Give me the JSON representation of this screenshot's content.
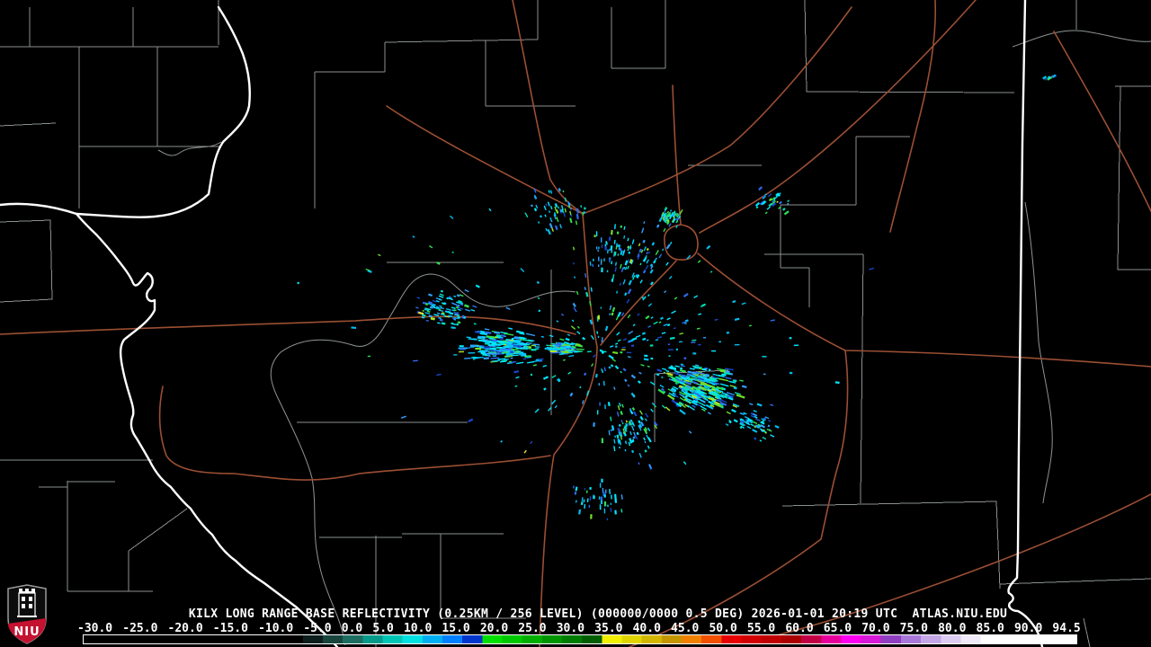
{
  "header": {
    "title": "KILX LONG RANGE BASE REFLECTIVITY (0.25KM / 256 LEVEL) (000000/0000 0.5 DEG) 2026-01-01 20:19 UTC  ATLAS.NIU.EDU"
  },
  "colorbar": {
    "range": {
      "min": -30.0,
      "max": 94.5
    },
    "ticks": [
      "-30.0",
      "-25.0",
      "-20.0",
      "-15.0",
      "-10.0",
      "-5.0",
      "0.0",
      "5.0",
      "10.0",
      "15.0",
      "20.0",
      "25.0",
      "30.0",
      "35.0",
      "40.0",
      "45.0",
      "50.0",
      "55.0",
      "60.0",
      "65.0",
      "70.0",
      "75.0",
      "80.0",
      "85.0",
      "90.0",
      "94.5"
    ],
    "stops": [
      {
        "v": -30,
        "c": "#000000"
      },
      {
        "v": -5,
        "c": "#000000"
      },
      {
        "v": -2.5,
        "c": "#0c1e1c"
      },
      {
        "v": 0,
        "c": "#17453e"
      },
      {
        "v": 2.5,
        "c": "#1d6e60"
      },
      {
        "v": 5,
        "c": "#069a8a"
      },
      {
        "v": 7.5,
        "c": "#00c4b4"
      },
      {
        "v": 10,
        "c": "#00e0e0"
      },
      {
        "v": 12.5,
        "c": "#00aef2"
      },
      {
        "v": 15,
        "c": "#0080ff"
      },
      {
        "v": 17.5,
        "c": "#0036cc"
      },
      {
        "v": 20,
        "c": "#00e000"
      },
      {
        "v": 22.5,
        "c": "#00c800"
      },
      {
        "v": 25,
        "c": "#00ae00"
      },
      {
        "v": 27.5,
        "c": "#009400"
      },
      {
        "v": 30,
        "c": "#007c00"
      },
      {
        "v": 32.5,
        "c": "#005e00"
      },
      {
        "v": 35,
        "c": "#f0f000"
      },
      {
        "v": 37.5,
        "c": "#e0d400"
      },
      {
        "v": 40,
        "c": "#d2b600"
      },
      {
        "v": 42.5,
        "c": "#c49600"
      },
      {
        "v": 45,
        "c": "#f08000"
      },
      {
        "v": 47.5,
        "c": "#f05000"
      },
      {
        "v": 50,
        "c": "#e60000"
      },
      {
        "v": 52.5,
        "c": "#d00000"
      },
      {
        "v": 55,
        "c": "#c00000"
      },
      {
        "v": 57.5,
        "c": "#aa0000"
      },
      {
        "v": 60,
        "c": "#c20046"
      },
      {
        "v": 62.5,
        "c": "#e8009c"
      },
      {
        "v": 65,
        "c": "#ff00f0"
      },
      {
        "v": 67.5,
        "c": "#d619d6"
      },
      {
        "v": 70,
        "c": "#8f3fc0"
      },
      {
        "v": 72.5,
        "c": "#a878d8"
      },
      {
        "v": 75,
        "c": "#c3a6e6"
      },
      {
        "v": 77.5,
        "c": "#dcccf2"
      },
      {
        "v": 80,
        "c": "#efe9f8"
      },
      {
        "v": 82.5,
        "c": "#ffffff"
      },
      {
        "v": 94.5,
        "c": "#ffffff"
      }
    ]
  },
  "logo": {
    "text": "NIU",
    "shield_red": "#c41230",
    "shield_outline": "#9a9a9a"
  },
  "map": {
    "background": "#000000",
    "county_line_color": "#9a9fa1",
    "road_color": "#9b4f33",
    "water_color": "#ffffff",
    "echo_palette": [
      {
        "c": "#00e6ff",
        "w": 0.3
      },
      {
        "c": "#00bff2",
        "w": 0.18
      },
      {
        "c": "#30a0ff",
        "w": 0.12
      },
      {
        "c": "#2e6bf0",
        "w": 0.11
      },
      {
        "c": "#1747cc",
        "w": 0.07
      },
      {
        "c": "#00e0b8",
        "w": 0.08
      },
      {
        "c": "#2ee24e",
        "w": 0.08
      },
      {
        "c": "#74dd28",
        "w": 0.04
      },
      {
        "c": "#b6e822",
        "w": 0.015
      },
      {
        "c": "#e8e13a",
        "w": 0.005
      }
    ]
  }
}
